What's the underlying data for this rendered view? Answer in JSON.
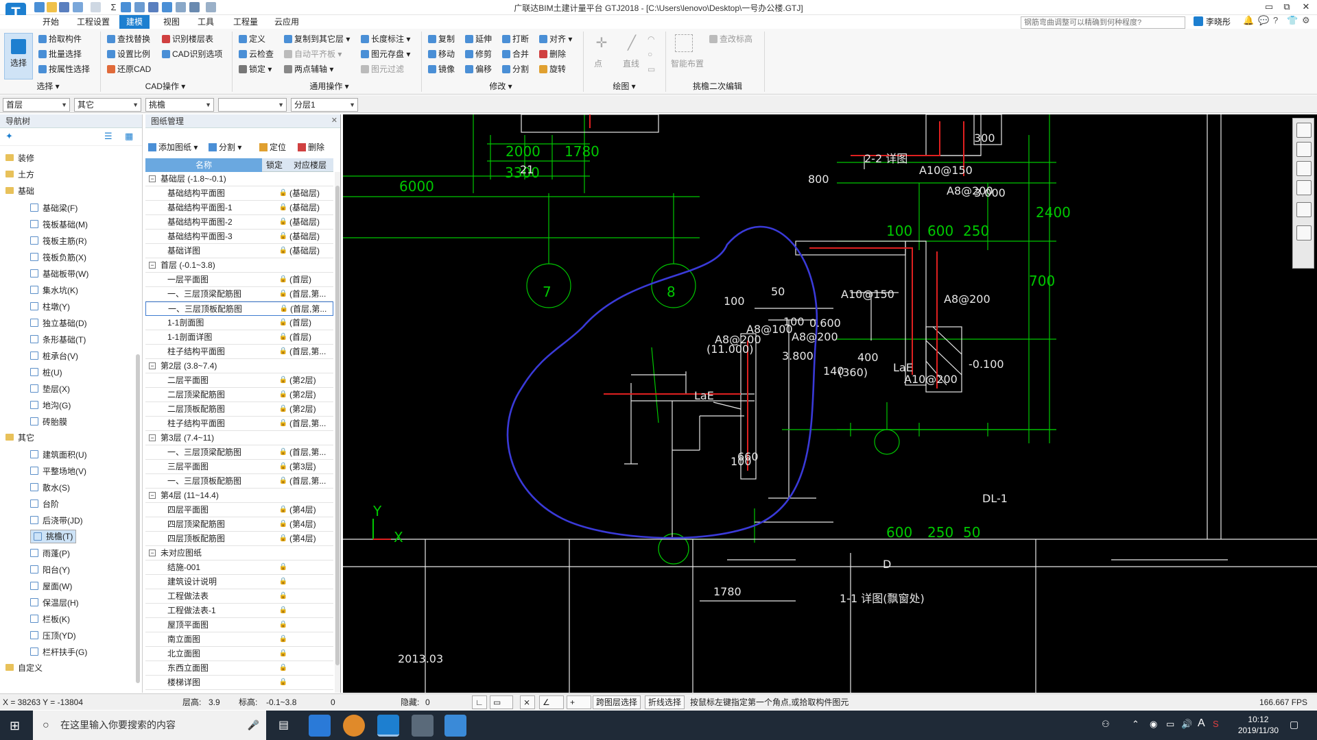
{
  "window": {
    "title": "广联达BIM土建计量平台 GTJ2018 - [C:\\Users\\lenovo\\Desktop\\一号办公楼.GTJ]"
  },
  "menu": {
    "items": [
      "开始",
      "工程设置",
      "建模",
      "视图",
      "工具",
      "工程量",
      "云应用"
    ],
    "active": "建模"
  },
  "search": {
    "placeholder": "钢筋弯曲调整可以精确到何种程度?"
  },
  "user": {
    "name": "李晓彤"
  },
  "ribbon": {
    "select_big": "选择",
    "select_items": [
      "拾取构件",
      "批量选择",
      "按属性选择"
    ],
    "select_group": "选择 ▾",
    "cad_col1": [
      "查找替换",
      "设置比例",
      "还原CAD"
    ],
    "cad_col2": [
      "识别楼层表",
      "CAD识别选项"
    ],
    "cad_group": "CAD操作 ▾",
    "common_col1": [
      "定义",
      "云检查",
      "锁定 ▾"
    ],
    "common_col2": [
      "复制到其它层 ▾",
      "自动平齐板 ▾",
      "两点辅轴 ▾"
    ],
    "common_col3": [
      "长度标注 ▾",
      "图元存盘 ▾",
      "图元过滤"
    ],
    "common_group": "通用操作 ▾",
    "modify_col1": [
      "复制",
      "移动",
      "镜像"
    ],
    "modify_col2": [
      "延伸",
      "修剪",
      "偏移"
    ],
    "modify_col3": [
      "打断",
      "合并",
      "分割"
    ],
    "modify_col4": [
      "对齐 ▾",
      "删除",
      "旋转"
    ],
    "modify_group": "修改 ▾",
    "draw_items": [
      "点",
      "直线"
    ],
    "draw_group": "绘图 ▾",
    "smart_label": "智能布置",
    "check_label": "查改标高",
    "edit2_group": "挑檐二次编辑"
  },
  "layerbar": {
    "floor": "首层",
    "category": "其它",
    "component": "挑檐",
    "blank": "",
    "sublayer": "分层1"
  },
  "nav": {
    "title": "导航树",
    "groups": [
      {
        "label": "装修",
        "items": []
      },
      {
        "label": "土方",
        "items": []
      },
      {
        "label": "基础",
        "items": [
          "基础梁(F)",
          "筏板基础(M)",
          "筏板主筋(R)",
          "筏板负筋(X)",
          "基础板带(W)",
          "集水坑(K)",
          "柱墩(Y)",
          "独立基础(D)",
          "条形基础(T)",
          "桩承台(V)",
          "桩(U)",
          "垫层(X)",
          "地沟(G)",
          "砖胎膜"
        ]
      },
      {
        "label": "其它",
        "items": [
          "建筑面积(U)",
          "平整场地(V)",
          "散水(S)",
          "台阶",
          "后浇带(JD)",
          "挑檐(T)",
          "雨蓬(P)",
          "阳台(Y)",
          "屋面(W)",
          "保温层(H)",
          "栏板(K)",
          "压顶(YD)",
          "栏杆扶手(G)"
        ]
      },
      {
        "label": "自定义",
        "items": []
      }
    ],
    "selected": "挑檐(T)"
  },
  "drawings": {
    "title": "图纸管理",
    "toolbar": {
      "add": "添加图纸 ▾",
      "split": "分割 ▾",
      "locate": "定位",
      "delete": "删除"
    },
    "headers": {
      "name": "名称",
      "lock": "锁定",
      "layer": "对应楼层"
    },
    "rows": [
      {
        "type": "group",
        "name": "基础层 (-1.8~-0.1)"
      },
      {
        "name": "基础结构平面图",
        "layer": "(基础层)"
      },
      {
        "name": "基础结构平面图-1",
        "layer": "(基础层)"
      },
      {
        "name": "基础结构平面图-2",
        "layer": "(基础层)"
      },
      {
        "name": "基础结构平面图-3",
        "layer": "(基础层)"
      },
      {
        "name": "基础详图",
        "layer": "(基础层)"
      },
      {
        "type": "group",
        "name": "首层 (-0.1~3.8)"
      },
      {
        "name": "一层平面图",
        "layer": "(首层)"
      },
      {
        "name": "一、三层顶梁配筋图",
        "layer": "(首层,第..."
      },
      {
        "name": "一、三层顶板配筋图",
        "layer": "(首层,第...",
        "hl": true
      },
      {
        "name": "1-1剖面图",
        "layer": "(首层)"
      },
      {
        "name": "1-1剖面详图",
        "layer": "(首层)"
      },
      {
        "name": "柱子结构平面图",
        "layer": "(首层,第..."
      },
      {
        "type": "group",
        "name": "第2层 (3.8~7.4)"
      },
      {
        "name": "二层平面图",
        "layer": "(第2层)"
      },
      {
        "name": "二层顶梁配筋图",
        "layer": "(第2层)"
      },
      {
        "name": "二层顶板配筋图",
        "layer": "(第2层)"
      },
      {
        "name": "柱子结构平面图",
        "layer": "(首层,第..."
      },
      {
        "type": "group",
        "name": "第3层 (7.4~11)"
      },
      {
        "name": "一、三层顶梁配筋图",
        "layer": "(首层,第..."
      },
      {
        "name": "三层平面图",
        "layer": "(第3层)"
      },
      {
        "name": "一、三层顶板配筋图",
        "layer": "(首层,第..."
      },
      {
        "type": "group",
        "name": "第4层 (11~14.4)"
      },
      {
        "name": "四层平面图",
        "layer": "(第4层)"
      },
      {
        "name": "四层顶梁配筋图",
        "layer": "(第4层)"
      },
      {
        "name": "四层顶板配筋图",
        "layer": "(第4层)"
      },
      {
        "type": "group",
        "name": "未对应图纸"
      },
      {
        "name": "结施-001",
        "layer": ""
      },
      {
        "name": "建筑设计说明",
        "layer": ""
      },
      {
        "name": "工程做法表",
        "layer": ""
      },
      {
        "name": "工程做法表-1",
        "layer": ""
      },
      {
        "name": "屋顶平面图",
        "layer": ""
      },
      {
        "name": "南立面图",
        "layer": ""
      },
      {
        "name": "北立面图",
        "layer": ""
      },
      {
        "name": "东西立面图",
        "layer": ""
      },
      {
        "name": "楼梯详图",
        "layer": ""
      }
    ]
  },
  "cad": {
    "dims": [
      "6000",
      "3300",
      "2000",
      "1780",
      "21",
      "7",
      "8",
      "100",
      "A8@100",
      "A8@200",
      "(11.000)",
      "3.800",
      "LaE",
      "A8@200",
      "400",
      "140",
      "(360)",
      "660",
      "100",
      "1780",
      "2-2 详图",
      "A10@150",
      "A8@200",
      "3.000",
      "300",
      "800",
      "100",
      "600",
      "250",
      "50",
      "A10@150",
      "0.600",
      "100",
      "A8@200",
      "LaE",
      "A10@200",
      "-0.100",
      "700",
      "2400",
      "DL-1",
      "600",
      "250",
      "50",
      "D",
      "1-1 详图(飘窗处)",
      "2013.03",
      "Y",
      "X"
    ]
  },
  "status": {
    "coords": "X = 38263 Y = -13804",
    "floor_height_label": "层高:",
    "floor_height": "3.9",
    "elev_label": "标高:",
    "elev": "-0.1~3.8",
    "zero": "0",
    "hidden_label": "隐藏:",
    "hidden": "0",
    "cross_select": "跨图层选择",
    "polyline_select": "折线选择",
    "hint": "按鼠标左键指定第一个角点,或拾取构件图元",
    "fps": "166.667 FPS"
  },
  "taskbar": {
    "search": "在这里输入你要搜索的内容",
    "time": "10:12",
    "date": "2019/11/30"
  },
  "colors": {
    "accent": "#1d7fd0",
    "cad_bg": "#000000",
    "cad_green": "#00c800",
    "cad_red": "#e02020",
    "cad_blue": "#3a3ad8"
  }
}
